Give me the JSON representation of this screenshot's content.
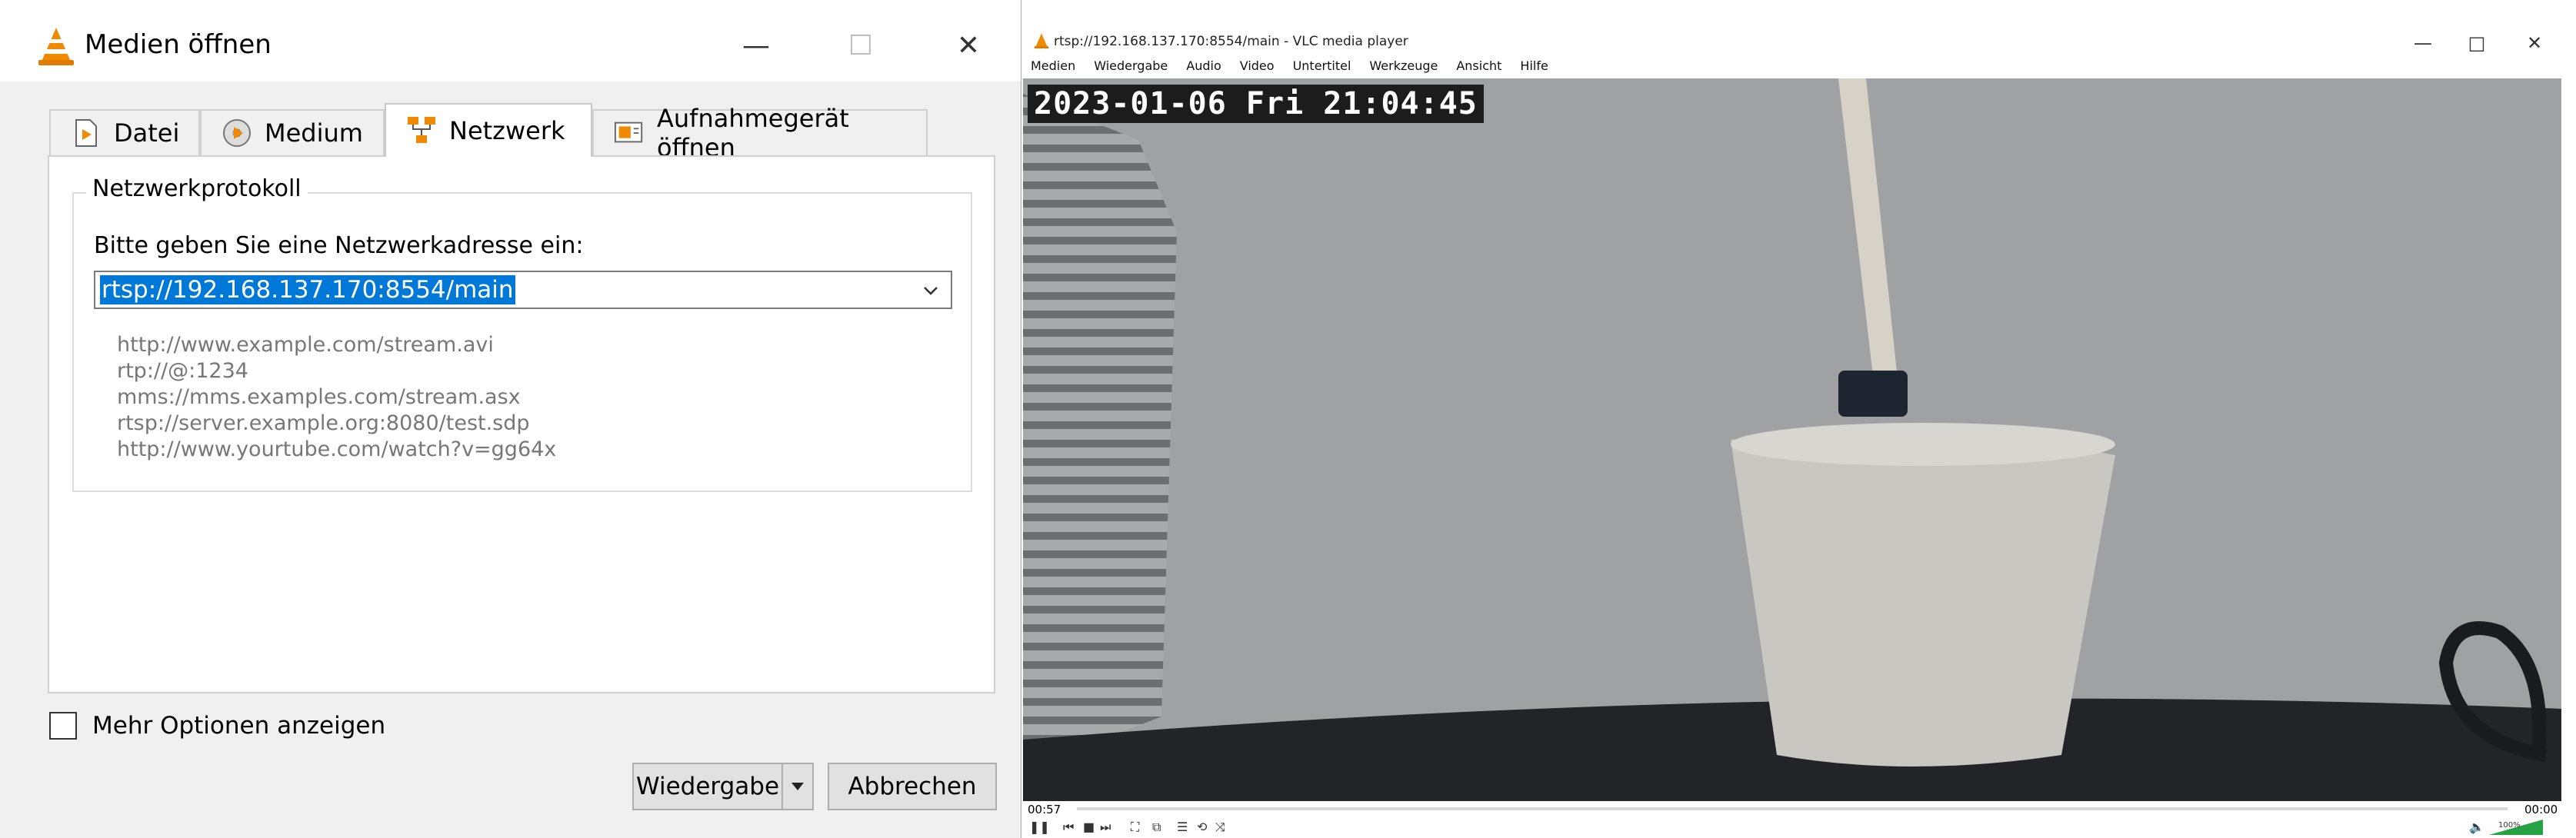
{
  "dialog": {
    "title": "Medien öffnen",
    "window_buttons": {
      "minimize": "—",
      "maximize": "☐",
      "close": "✕"
    },
    "tabs": [
      {
        "label": "Datei",
        "icon": "file-icon"
      },
      {
        "label": "Medium",
        "icon": "disc-icon"
      },
      {
        "label": "Netzwerk",
        "icon": "network-icon"
      },
      {
        "label": "Aufnahmegerät öffnen",
        "icon": "capture-device-icon"
      }
    ],
    "active_tab": "Netzwerk",
    "group_title": "Netzwerkprotokoll",
    "prompt": "Bitte geben Sie eine Netzwerkadresse ein:",
    "url_value": "rtsp://192.168.137.170:8554/main",
    "examples": [
      "http://www.example.com/stream.avi",
      "rtp://@:1234",
      "mms://mms.examples.com/stream.asx",
      "rtsp://server.example.org:8080/test.sdp",
      "http://www.yourtube.com/watch?v=gg64x"
    ],
    "more_options_label": "Mehr Optionen anzeigen",
    "play_button": "Wiedergabe",
    "cancel_button": "Abbrechen"
  },
  "player": {
    "title": "rtsp://192.168.137.170:8554/main - VLC media player",
    "menu": [
      "Medien",
      "Wiedergabe",
      "Audio",
      "Video",
      "Untertitel",
      "Werkzeuge",
      "Ansicht",
      "Hilfe"
    ],
    "window_buttons": {
      "minimize": "—",
      "maximize": "□",
      "close": "✕"
    },
    "timestamp": "2023-01-06 Fri 21:04:45",
    "elapsed": "00:57",
    "remaining": "00:00",
    "volume": "100%",
    "controls": [
      "pause-icon",
      "prev-icon",
      "stop-icon",
      "next-icon",
      "fullscreen-icon",
      "extended-settings-icon",
      "playlist-icon",
      "loop-icon",
      "shuffle-icon"
    ]
  },
  "colors": {
    "accent": "#0078d7",
    "vlc_orange": "#f08a00",
    "dialog_bg": "#f0f0f0"
  }
}
